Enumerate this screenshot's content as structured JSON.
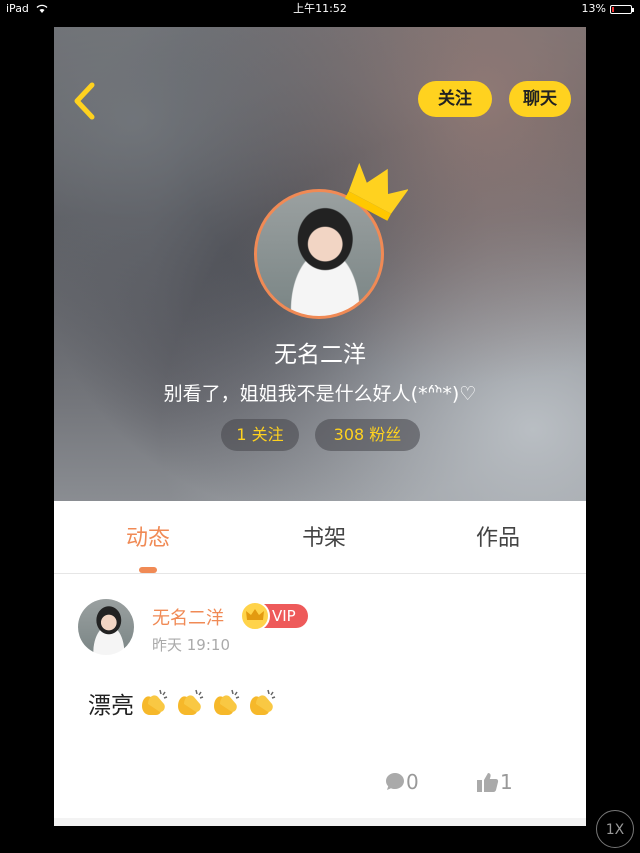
{
  "status_bar": {
    "device": "iPad",
    "time": "上午11:52",
    "battery": "13%",
    "battery_level": 0.13
  },
  "header": {
    "follow_label": "关注",
    "chat_label": "聊天",
    "back_icon": "chevron-left-icon"
  },
  "profile": {
    "nickname": "无名二洋",
    "bio": "别看了，姐姐我不是什么好人(*ᐢ́ᐢ̀*)♡",
    "following": "1 关注",
    "fans": "308 粉丝"
  },
  "tabs": [
    {
      "label": "动态",
      "active": true
    },
    {
      "label": "书架",
      "active": false
    },
    {
      "label": "作品",
      "active": false
    }
  ],
  "post": {
    "author": "无名二洋",
    "vip_label": "VIP",
    "time": "昨天 19:10",
    "text": "漂亮",
    "comments": "0",
    "likes": "1"
  },
  "overlay": {
    "speed_label": "1X"
  },
  "colors": {
    "accent": "#f08a55",
    "button_yellow": "#ffd21f",
    "vip_red": "#ee5a5a"
  }
}
